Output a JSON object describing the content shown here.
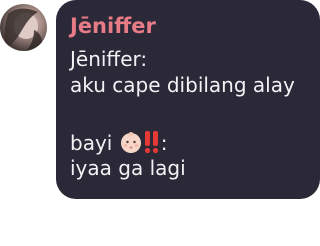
{
  "sender": {
    "name": "Jēniffer",
    "name_color": "#e77c87"
  },
  "message": {
    "line1": "Jēniffer:",
    "line2": "aku cape dibilang alay",
    "line3_prefix": "bayi",
    "line3_suffix": ":",
    "line4": "iyaa ga lagi",
    "emojis": [
      "baby-face-icon",
      "double-exclamation-icon"
    ]
  },
  "colors": {
    "bubble_bg": "#2b2838",
    "text": "#f2f2f4"
  }
}
